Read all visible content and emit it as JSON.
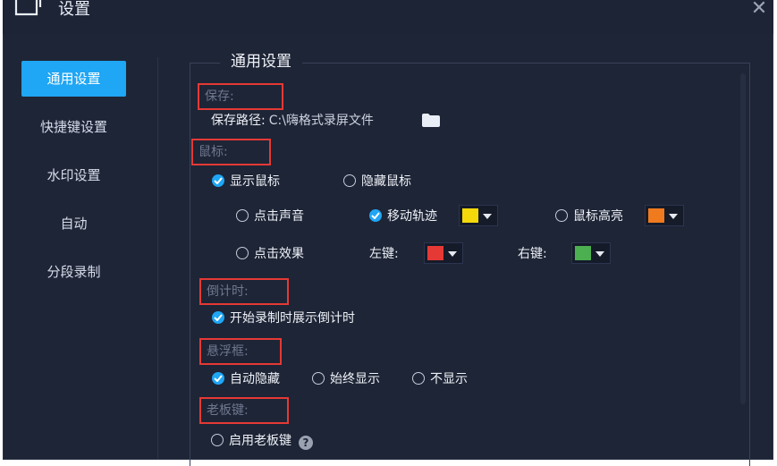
{
  "window": {
    "title": "设置",
    "close_glyph": "✕"
  },
  "sidebar": {
    "items": [
      {
        "label": "通用设置",
        "active": true
      },
      {
        "label": "快捷键设置"
      },
      {
        "label": "水印设置"
      },
      {
        "label": "自动"
      },
      {
        "label": "分段录制"
      }
    ]
  },
  "panel": {
    "legend": "通用设置",
    "save": {
      "header": "保存:",
      "path_label": "保存路径:",
      "path_value": "C:\\嗨格式录屏文件",
      "icon": "folder-icon"
    },
    "mouse": {
      "header": "鼠标:",
      "show_cursor": "显示鼠标",
      "hide_cursor": "隐藏鼠标",
      "click_sound": "点击声音",
      "move_track": "移动轨迹",
      "move_track_color": "#f5d90a",
      "highlight": "鼠标高亮",
      "highlight_color": "#f07a1e",
      "click_effect": "点击效果",
      "left_label": "左键:",
      "left_color": "#e53935",
      "right_label": "右键:",
      "right_color": "#4caf50"
    },
    "countdown": {
      "header": "倒计时:",
      "show_countdown": "开始录制时展示倒计时"
    },
    "float_box": {
      "header": "悬浮框:",
      "auto_hide": "自动隐藏",
      "always_show": "始终显示",
      "no_show": "不显示"
    },
    "boss_key": {
      "header": "老板键:",
      "enable": "启用老板键",
      "help_glyph": "?"
    }
  },
  "colors": {
    "accent": "#1fa6f5",
    "highlight_box": "#e53935",
    "background": "#1e2536"
  }
}
